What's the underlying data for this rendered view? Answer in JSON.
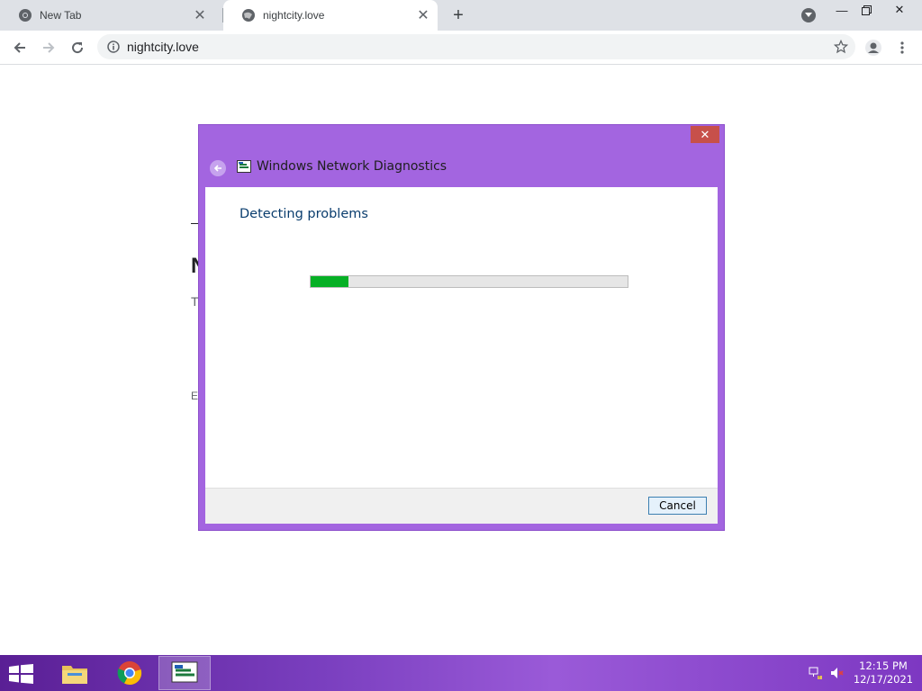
{
  "browser": {
    "tabs": [
      {
        "title": "New Tab",
        "icon": "chrome-icon",
        "active": false
      },
      {
        "title": "nightcity.love",
        "icon": "globe-icon",
        "active": true
      }
    ],
    "address": "nightcity.love"
  },
  "page": {
    "fragments": [
      "N",
      "T",
      "E"
    ]
  },
  "dialog": {
    "title": "Windows Network Diagnostics",
    "heading": "Detecting problems",
    "progress_percent": 12,
    "cancel_label": "Cancel",
    "close_icon": "close-icon"
  },
  "taskbar": {
    "apps": [
      "file-explorer-icon",
      "chrome-icon",
      "network-diagnostics-icon"
    ],
    "tray": [
      "network-icon",
      "speaker-muted-icon"
    ],
    "time": "12:15 PM",
    "date": "12/17/2021",
    "colors": {
      "accent": "#8b4fd0"
    }
  }
}
